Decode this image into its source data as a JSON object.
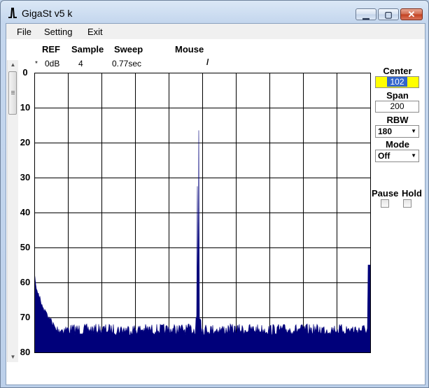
{
  "window": {
    "title": "GigaSt v5 k"
  },
  "menu": {
    "file": "File",
    "setting": "Setting",
    "exit": "Exit"
  },
  "header": {
    "ref_label": "REF",
    "sample_label": "Sample",
    "sweep_label": "Sweep",
    "mouse_label": "Mouse",
    "marker": "*",
    "ref_value": "0dB",
    "sample_value": "4",
    "sweep_value": "0.77sec",
    "mouse_value": "/"
  },
  "controls": {
    "center_label": "Center",
    "center_value": "102",
    "span_label": "Span",
    "span_value": "200",
    "rbw_label": "RBW",
    "rbw_value": "180",
    "mode_label": "Mode",
    "mode_value": "Off",
    "pause_label": "Pause",
    "hold_label": "Hold",
    "pause_checked": false,
    "hold_checked": false
  },
  "colors": {
    "trace": "#00007a",
    "grid": "#000000",
    "highlight": "#ffff00"
  },
  "chart_data": {
    "type": "area",
    "ylabels": [
      "0",
      "10",
      "20",
      "30",
      "40",
      "50",
      "60",
      "70",
      "80"
    ],
    "ylim": [
      0,
      80
    ],
    "x_divisions": 10,
    "y_divisions": 8,
    "grid": true,
    "noise_floor_db": 73,
    "left_edge_peak_db": 56,
    "right_edge_peak_db": 55,
    "peaks": [
      {
        "x_fraction": 0.49,
        "value_db": 16.5
      },
      {
        "x_fraction": 0.486,
        "value_db": 32.5
      }
    ]
  }
}
